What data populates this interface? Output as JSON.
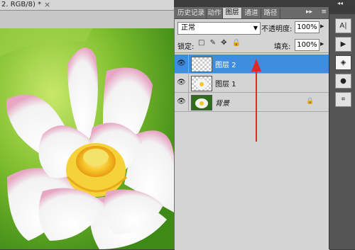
{
  "document": {
    "tab_label": "2. RGB/8) *",
    "close_glyph": "×"
  },
  "panel": {
    "tabs": [
      {
        "label": "历史记录",
        "active": false
      },
      {
        "label": "动作",
        "active": false
      },
      {
        "label": "图层",
        "active": true
      },
      {
        "label": "通道",
        "active": false
      },
      {
        "label": "路径",
        "active": false
      }
    ],
    "collapse_glyph": "▸▸",
    "menu_glyph": "≡",
    "blend_mode": "正常",
    "opacity_label": "不透明度:",
    "opacity_value": "100%",
    "lock_label": "锁定:",
    "lock_icons": "□ ✎ ✥ 🔒",
    "fill_label": "填充:",
    "fill_value": "100%",
    "layers": [
      {
        "name": "图层 2",
        "selected": true,
        "thumb": "transparent",
        "locked": false
      },
      {
        "name": "图层 1",
        "selected": false,
        "thumb": "flower",
        "locked": false
      },
      {
        "name": "背景",
        "selected": false,
        "thumb": "flower-dark",
        "locked": true
      }
    ]
  },
  "colors": {
    "selection": "#3e8ddf",
    "panel_bg": "#d4d4d4",
    "arrow": "#e02828"
  },
  "toolstrip": {
    "icons": [
      "text-icon",
      "play-icon",
      "layers-icon",
      "mask-icon",
      "crop-icon"
    ]
  }
}
